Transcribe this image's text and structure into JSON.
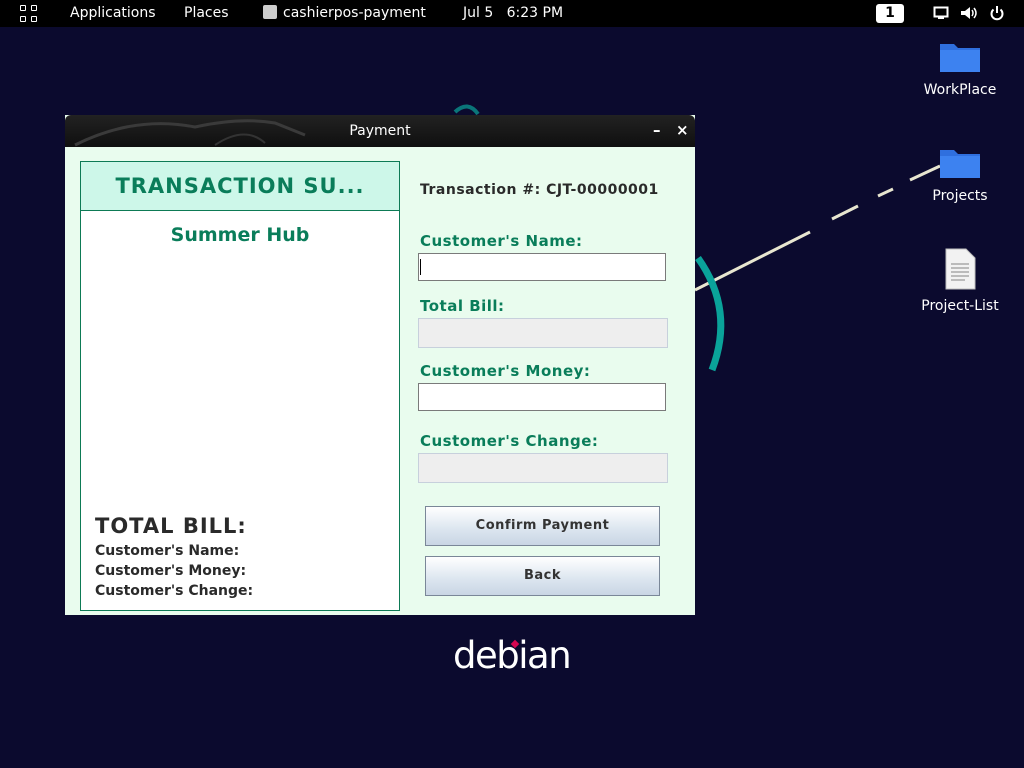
{
  "topbar": {
    "applications": "Applications",
    "places": "Places",
    "active_app": "cashierpos-payment",
    "date": "Jul 5",
    "time": "6:23 PM",
    "workspace": "1",
    "icons": [
      "activities-grid-icon",
      "java-app-icon",
      "screen-icon",
      "volume-icon",
      "power-icon"
    ]
  },
  "desktop": {
    "icons": [
      {
        "label": "WorkPlace",
        "icon": "folder-icon"
      },
      {
        "label": "Projects",
        "icon": "folder-icon"
      },
      {
        "label": "Project-List",
        "icon": "document-icon"
      }
    ],
    "logo_text": "debian",
    "colors": {
      "background": "#0b0a2e",
      "folder": "#2f6fde",
      "logo_dot": "#d70751"
    }
  },
  "window": {
    "title": "Payment",
    "minimize_label": "–",
    "close_label": "×",
    "receipt": {
      "header": "TRANSACTION SU...",
      "store_name": "Summer Hub",
      "total_bill": "TOTAL BILL:",
      "customer_name": "Customer's Name:",
      "customer_money": "Customer's Money:",
      "customer_change": "Customer's Change:"
    },
    "form": {
      "transaction": "Transaction #: CJT-00000001",
      "name_label": "Customer's Name:",
      "name_value": "",
      "bill_label": "Total Bill:",
      "bill_value": "",
      "money_label": "Customer's Money:",
      "money_value": "",
      "change_label": "Customer's Change:",
      "change_value": ""
    },
    "buttons": {
      "confirm": "Confirm Payment",
      "back": "Back"
    },
    "colors": {
      "accent": "#0a7d5a",
      "panel_bg": "#e9fcee",
      "header_bg": "#cdf7e9"
    }
  }
}
